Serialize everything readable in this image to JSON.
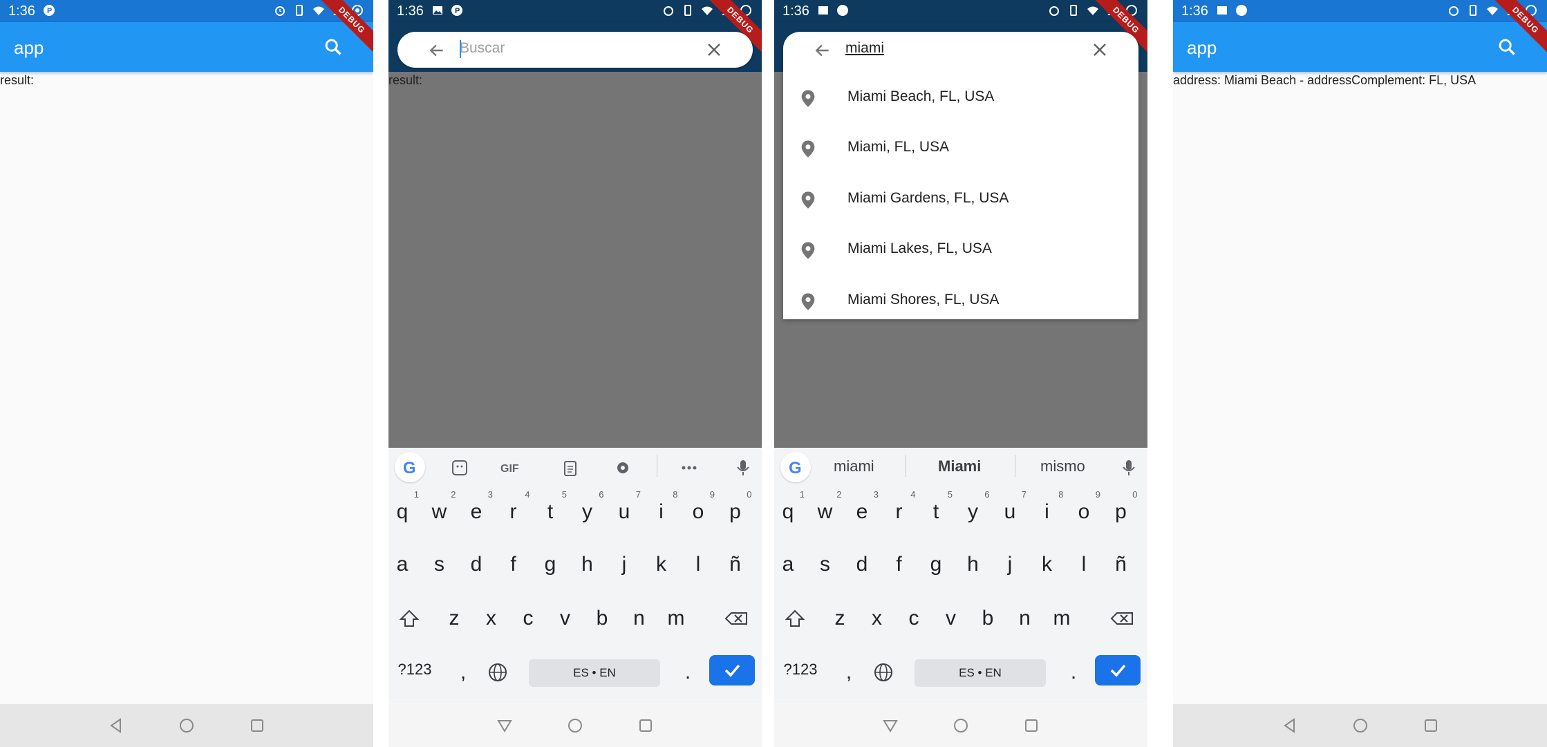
{
  "colors": {
    "primary": "#2196f3",
    "debug": "#b71c1c",
    "overlay": "#757575",
    "enter": "#1a73e8"
  },
  "status": {
    "time": "1:36"
  },
  "debug_banner": "DEBUG",
  "screen1": {
    "title": "app",
    "result": "result:"
  },
  "screen2": {
    "placeholder": "Buscar",
    "result": "result:"
  },
  "screen3": {
    "query": "miami",
    "places": [
      "Miami Beach, FL, USA",
      "Miami, FL, USA",
      "Miami Gardens, FL, USA",
      "Miami Lakes, FL, USA",
      "Miami Shores, FL, USA"
    ],
    "suggestions": [
      "miami",
      "Miami",
      "mismo"
    ]
  },
  "screen4": {
    "title": "app",
    "result": "address: Miami Beach - addressComplement:  FL, USA"
  },
  "keyboard": {
    "row1": [
      "q",
      "w",
      "e",
      "r",
      "t",
      "y",
      "u",
      "i",
      "o",
      "p"
    ],
    "row1_hints": [
      "1",
      "2",
      "3",
      "4",
      "5",
      "6",
      "7",
      "8",
      "9",
      "0"
    ],
    "row2": [
      "a",
      "s",
      "d",
      "f",
      "g",
      "h",
      "j",
      "k",
      "l",
      "ñ"
    ],
    "row3": [
      "z",
      "x",
      "c",
      "v",
      "b",
      "n",
      "m"
    ],
    "symbols": "?123",
    "space": "ES • EN",
    "period": ".",
    "comma": ",",
    "gif": "GIF"
  }
}
